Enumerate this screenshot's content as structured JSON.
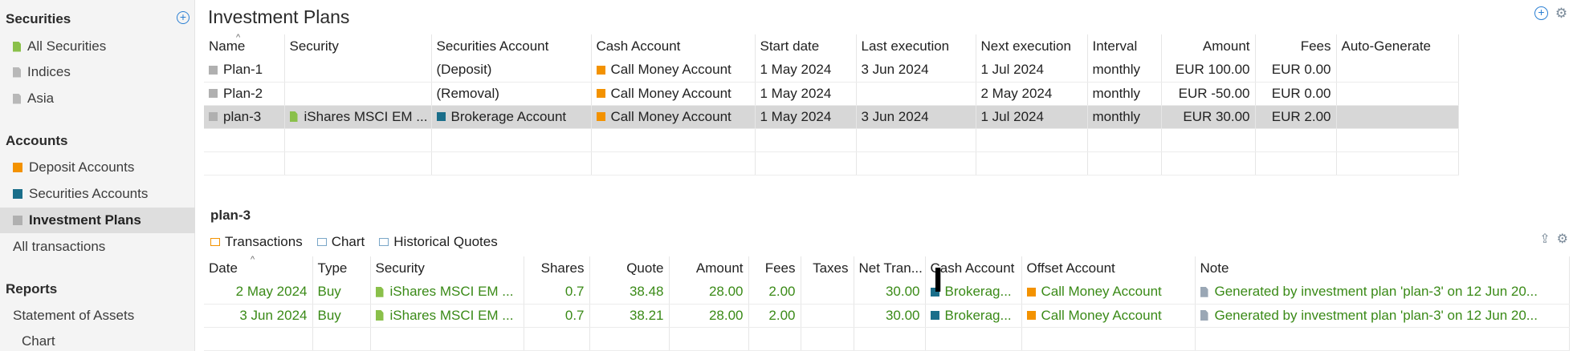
{
  "sidebar": {
    "sections": [
      {
        "title": "Securities",
        "items": [
          {
            "label": "All Securities",
            "icon": "security-green-icon"
          },
          {
            "label": "Indices",
            "icon": "security-grey-icon"
          },
          {
            "label": "Asia",
            "icon": "security-grey-icon"
          }
        ]
      },
      {
        "title": "Accounts",
        "items": [
          {
            "label": "Deposit Accounts",
            "icon": "deposit-account-icon"
          },
          {
            "label": "Securities Accounts",
            "icon": "securities-account-icon"
          },
          {
            "label": "Investment Plans",
            "icon": "investment-plan-icon",
            "selected": true
          },
          {
            "label": "All transactions",
            "icon": ""
          }
        ]
      },
      {
        "title": "Reports",
        "items": [
          {
            "label": "Statement of Assets",
            "icon": ""
          },
          {
            "label": "Chart",
            "icon": ""
          }
        ]
      }
    ],
    "add_symbol": "+"
  },
  "main": {
    "title": "Investment Plans",
    "plans_table": {
      "columns": [
        "Name",
        "Security",
        "Securities Account",
        "Cash Account",
        "Start date",
        "Last execution",
        "Next execution",
        "Interval",
        "Amount",
        "Fees",
        "Auto-Generate"
      ],
      "rows": [
        {
          "name": "Plan-1",
          "security": "",
          "securities_account": "(Deposit)",
          "cash_account": "Call Money Account",
          "start": "1 May 2024",
          "last": "3 Jun 2024",
          "next": "1 Jul 2024",
          "interval": "monthly",
          "amount": "EUR 100.00",
          "fees": "EUR 0.00",
          "auto": ""
        },
        {
          "name": "Plan-2",
          "security": "",
          "securities_account": "(Removal)",
          "cash_account": "Call Money Account",
          "start": "1 May 2024",
          "last": "",
          "next": "2 May 2024",
          "interval": "monthly",
          "amount": "EUR -50.00",
          "fees": "EUR 0.00",
          "auto": ""
        },
        {
          "name": "plan-3",
          "security": "iShares MSCI EM ...",
          "securities_account": "Brokerage Account",
          "cash_account": "Call Money Account",
          "start": "1 May 2024",
          "last": "3 Jun 2024",
          "next": "1 Jul 2024",
          "interval": "monthly",
          "amount": "EUR 30.00",
          "fees": "EUR 2.00",
          "auto": ""
        }
      ]
    },
    "selected_plan": "plan-3",
    "tabs": [
      {
        "label": "Transactions",
        "active": true
      },
      {
        "label": "Chart",
        "active": false
      },
      {
        "label": "Historical Quotes",
        "active": false
      }
    ],
    "tx_table": {
      "columns": [
        "Date",
        "Type",
        "Security",
        "Shares",
        "Quote",
        "Amount",
        "Fees",
        "Taxes",
        "Net Tran...",
        "Cash Account",
        "Offset Account",
        "Note"
      ],
      "rows": [
        {
          "date": "2 May 2024",
          "type": "Buy",
          "security": "iShares MSCI EM ...",
          "shares": "0.7",
          "quote": "38.48",
          "amount": "28.00",
          "fees": "2.00",
          "taxes": "",
          "net": "30.00",
          "cash": "Brokerag...",
          "offset": "Call Money Account",
          "note": "Generated by investment plan 'plan-3' on 12 Jun 20..."
        },
        {
          "date": "3 Jun 2024",
          "type": "Buy",
          "security": "iShares MSCI EM ...",
          "shares": "0.7",
          "quote": "38.21",
          "amount": "28.00",
          "fees": "2.00",
          "taxes": "",
          "net": "30.00",
          "cash": "Brokerag...",
          "offset": "Call Money Account",
          "note": "Generated by investment plan 'plan-3' on 12 Jun 20..."
        }
      ]
    }
  },
  "colors": {
    "accent": "#2a7fd3",
    "deposit": "#f39200",
    "securities_account": "#1a6e8a",
    "security": "#8ac04a",
    "tx_text": "#3a8a17",
    "selection": "#d7d7d7"
  }
}
